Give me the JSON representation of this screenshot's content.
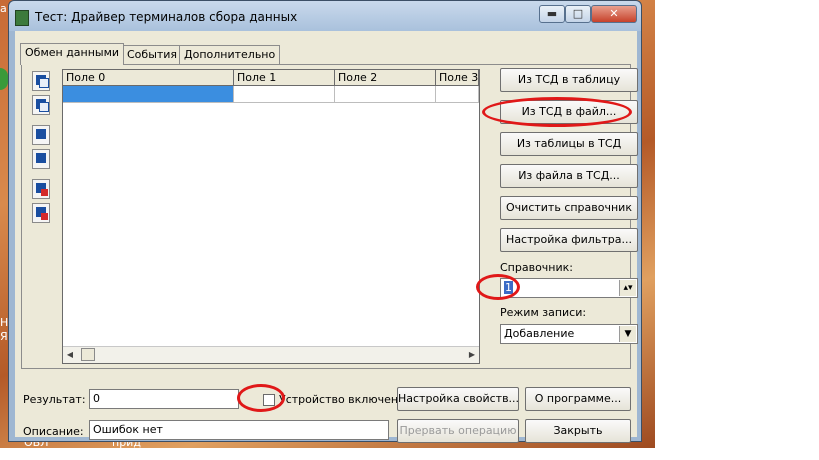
{
  "window": {
    "title": "Тест: Драйвер терминалов сбора данных",
    "minimize_glyph": "▬",
    "maximize_glyph": "□",
    "close_glyph": "✕"
  },
  "desktop_fragments": [
    "а",
    "Н",
    "Я",
    "ОБЛ",
    "прид"
  ],
  "tabs": [
    "Обмен данными",
    "События",
    "Дополнительно"
  ],
  "grid": {
    "columns": [
      "Поле 0",
      "Поле 1",
      "Поле 2",
      "Поле 3"
    ],
    "rows": [
      [
        "",
        "",
        "",
        ""
      ]
    ]
  },
  "scroll": {
    "left": "◀",
    "right": "▶"
  },
  "buttons": {
    "from_tsd_table": "Из ТСД в таблицу",
    "from_tsd_file": "Из ТСД в файл...",
    "table_to_tsd": "Из таблицы в ТСД",
    "file_to_tsd": "Из файла в ТСД...",
    "clear_ref": "Очистить справочник",
    "filter_setup": "Настройка фильтра...",
    "props_setup": "Настройка свойств...",
    "about": "О программе...",
    "abort": "Прервать операцию",
    "close": "Закрыть"
  },
  "reference": {
    "label": "Справочник:",
    "value": "1"
  },
  "write_mode": {
    "label": "Режим записи:",
    "value": "Добавление"
  },
  "result": {
    "label": "Результат:",
    "value": "0"
  },
  "device": {
    "label": "Устройство включено",
    "checked": false
  },
  "description": {
    "label": "Описание:",
    "value": "Ошибок нет"
  }
}
